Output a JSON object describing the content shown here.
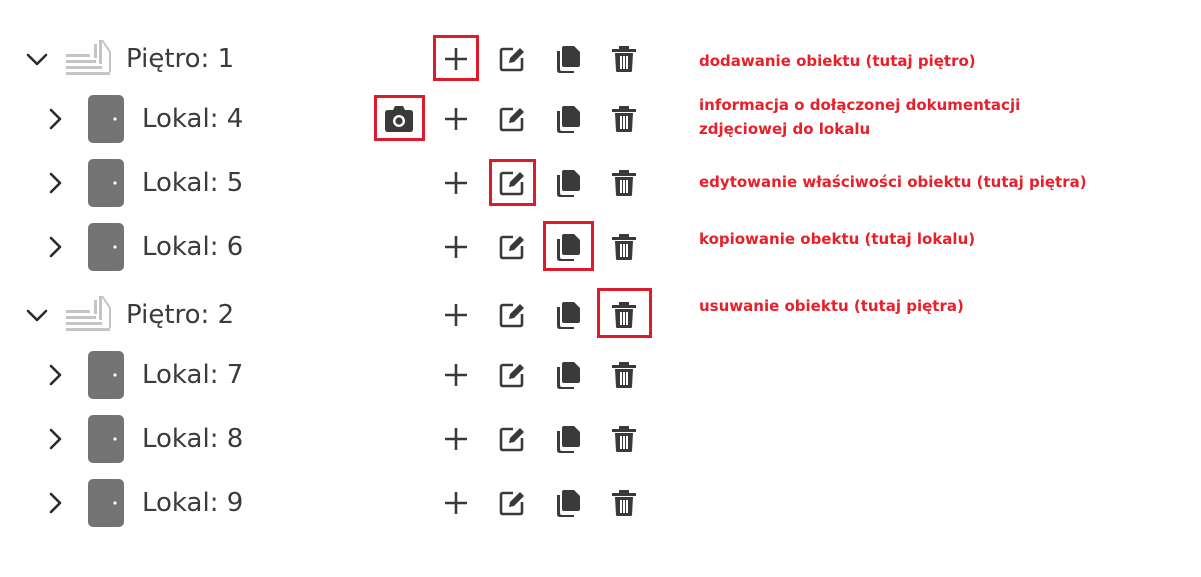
{
  "colors": {
    "icon": "#3a3a3a",
    "chevron": "#2b2b2b",
    "floor_icon": "#c4c4c4",
    "door": "#737373",
    "highlight": "#dc1c2c",
    "annotation": "#e8202a"
  },
  "tree": {
    "nodes": [
      {
        "type": "floor",
        "label": "Piętro: 1",
        "expanded": true,
        "icon": "stairs-icon"
      },
      {
        "type": "unit",
        "label": "Lokal: 4",
        "expanded": false,
        "icon": "door-icon",
        "has_photo": true
      },
      {
        "type": "unit",
        "label": "Lokal: 5",
        "expanded": false,
        "icon": "door-icon"
      },
      {
        "type": "unit",
        "label": "Lokal: 6",
        "expanded": false,
        "icon": "door-icon"
      },
      {
        "type": "floor",
        "label": "Piętro: 2",
        "expanded": true,
        "icon": "stairs-icon"
      },
      {
        "type": "unit",
        "label": "Lokal: 7",
        "expanded": false,
        "icon": "door-icon"
      },
      {
        "type": "unit",
        "label": "Lokal: 8",
        "expanded": false,
        "icon": "door-icon"
      },
      {
        "type": "unit",
        "label": "Lokal: 9",
        "expanded": false,
        "icon": "door-icon"
      }
    ],
    "actions": [
      "plus-icon",
      "edit-icon",
      "copy-icon",
      "trash-icon"
    ]
  },
  "annotations": {
    "add": [
      "dodawanie obiektu (tutaj piętro)"
    ],
    "photo": [
      "informacja o dołączonej dokumentacji",
      "zdjęciowej do lokalu"
    ],
    "edit": [
      "edytowanie właściwości obiektu (tutaj piętra)"
    ],
    "copy": [
      "kopiowanie obektu (tutaj lokalu)"
    ],
    "delete": [
      "usuwanie obiektu (tutaj piętra)"
    ]
  }
}
